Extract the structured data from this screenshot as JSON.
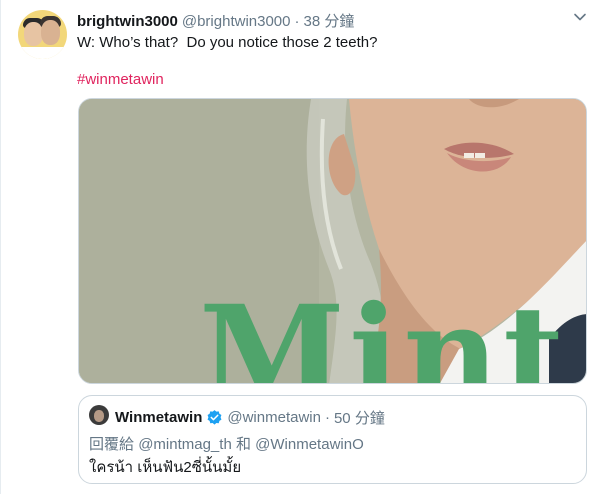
{
  "tweet": {
    "display_name": "brightwin3000",
    "handle": "@brightwin3000",
    "separator": "·",
    "time": "38 分鐘",
    "text": "W: Who’s that?  Do you notice those 2 teeth?",
    "hashtag": "#winmetawin",
    "media": {
      "overlay_text": "Mint"
    }
  },
  "quoted_tweet": {
    "display_name": "Winmetawin",
    "handle": "@winmetawin",
    "separator": "·",
    "time": "50 分鐘",
    "reply_prefix": "回覆給",
    "reply_mention_1": "@mintmag_th",
    "reply_conj": "和",
    "reply_mention_2": "@WinmetawinO",
    "text": "ใครน้า เห็นฟัน2ซี่นั้นมั้ย"
  },
  "colors": {
    "hashtag": "#e0245e",
    "verified": "#1da1f2",
    "secondary_text": "#657786",
    "border": "#ccd6dd",
    "mint_green": "#4fa46b"
  },
  "icons": [
    "chevron-down-icon",
    "verified-badge-icon"
  ]
}
